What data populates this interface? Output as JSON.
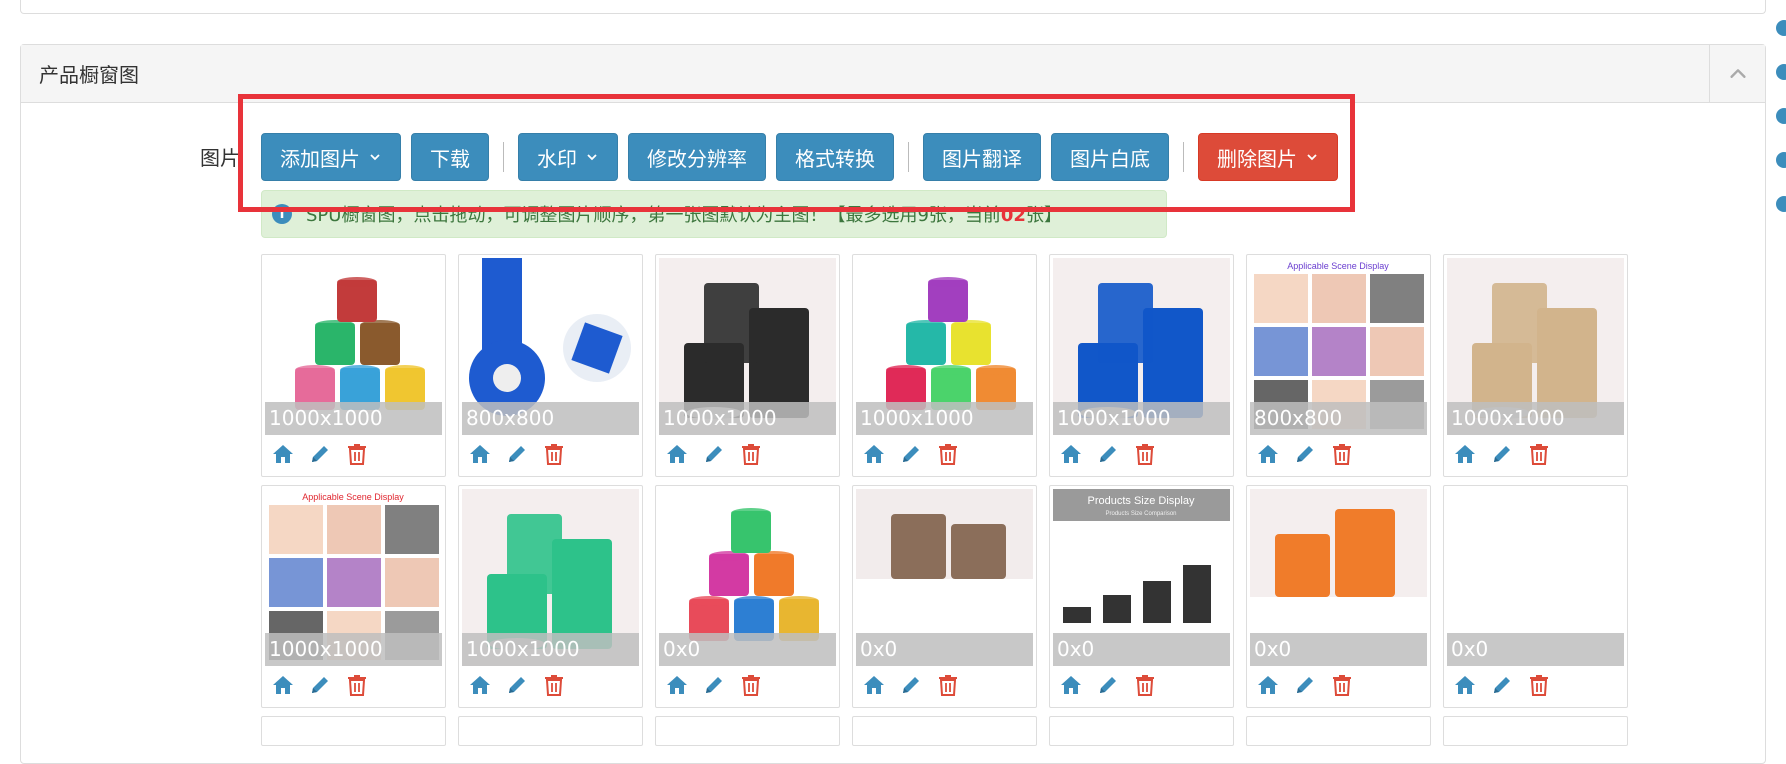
{
  "panel": {
    "title": "产品橱窗图",
    "field_label": "图片"
  },
  "toolbar": {
    "add_image": "添加图片",
    "download": "下载",
    "watermark": "水印",
    "resize": "修改分辨率",
    "format": "格式转换",
    "translate": "图片翻译",
    "white_bg": "图片白底",
    "delete": "删除图片"
  },
  "alert": {
    "text_before": "SPU橱窗图，点击拖动，可调整图片顺序，第一张图默认为主图！【最多选用9张，当前",
    "count": "02",
    "text_after": "张】"
  },
  "colors": {
    "primary": "#3c8dbc",
    "danger": "#dd4b39",
    "highlight": "#e8333a",
    "alert_bg": "#dff0d8"
  },
  "images": [
    {
      "size": "1000x1000",
      "caption": ""
    },
    {
      "size": "800x800",
      "caption": ""
    },
    {
      "size": "1000x1000",
      "caption": "black"
    },
    {
      "size": "1000x1000",
      "caption": ""
    },
    {
      "size": "1000x1000",
      "caption": "blue"
    },
    {
      "size": "800x800",
      "caption": "Applicable Scene Display"
    },
    {
      "size": "1000x1000",
      "caption": "Beige"
    },
    {
      "size": "1000x1000",
      "caption": "Applicable Scene Display"
    },
    {
      "size": "1000x1000",
      "caption": "Green"
    },
    {
      "size": "0x0",
      "caption": ""
    },
    {
      "size": "0x0",
      "caption": ""
    },
    {
      "size": "0x0",
      "caption": "Products Size Display"
    },
    {
      "size": "0x0",
      "caption": ""
    },
    {
      "size": "0x0",
      "caption": ""
    }
  ],
  "size_sub": "Products Size Comparison",
  "icons": [
    "home-icon",
    "edit-icon",
    "trash-icon"
  ]
}
